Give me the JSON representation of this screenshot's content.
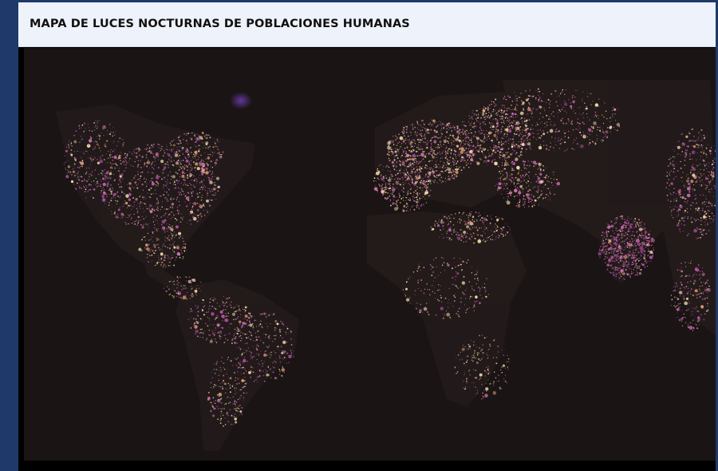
{
  "title": "MAPA DE LUCES NOCTURNAS DE POBLACIONES HUMANAS",
  "colors": {
    "page_background": "#1f3a6a",
    "header_background": "#eef2fa",
    "map_background": "#1a1414",
    "light_pale": "#f3dcae",
    "light_orange": "#e7a37a",
    "light_pink": "#cc6fb0",
    "light_magenta": "#b24fa6",
    "light_violet": "#6b3aa8"
  },
  "icons": []
}
